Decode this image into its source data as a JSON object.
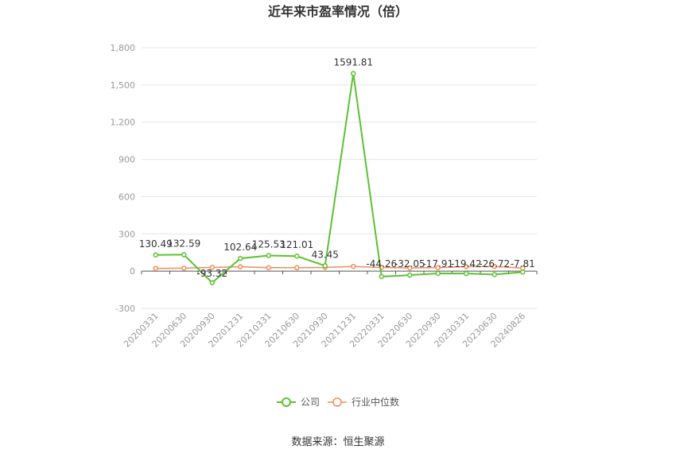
{
  "chart_data": {
    "type": "line",
    "title": "近年来市盈率情况（倍）",
    "categories": [
      "20200331",
      "20200630",
      "20200930",
      "20201231",
      "20210331",
      "20210630",
      "20210930",
      "20211231",
      "20220331",
      "20220630",
      "20220930",
      "20230331",
      "20230630",
      "20240826"
    ],
    "series": [
      {
        "name": "公司",
        "color": "#5cc132",
        "values": [
          130.49,
          132.59,
          -93.32,
          102.64,
          125.53,
          121.01,
          43.45,
          1591.81,
          -44.26,
          -32.05,
          -17.91,
          -19.42,
          -26.72,
          -7.81
        ],
        "labels": [
          "130.49",
          "132.59",
          "-93.32",
          "102.64",
          "125.53",
          "121.01",
          "43.45",
          "1591.81",
          "-44.26",
          "-32.05",
          "-17.91",
          "-19.42",
          "-26.72",
          "-7.81"
        ]
      },
      {
        "name": "行业中位数",
        "color": "#f08c5a",
        "values": [
          22,
          24,
          30,
          35,
          28,
          28,
          30,
          38,
          30,
          26,
          28,
          36,
          38,
          24
        ]
      }
    ],
    "ylim": [
      -300,
      1800
    ],
    "yticks": [
      -300,
      0,
      300,
      600,
      900,
      1200,
      1500,
      1800
    ],
    "ytick_labels": [
      "-300",
      "0",
      "300",
      "600",
      "900",
      "1,200",
      "1,500",
      "1,800"
    ],
    "grid": true,
    "legend": "bottom-center"
  },
  "source": "数据来源：恒生聚源"
}
